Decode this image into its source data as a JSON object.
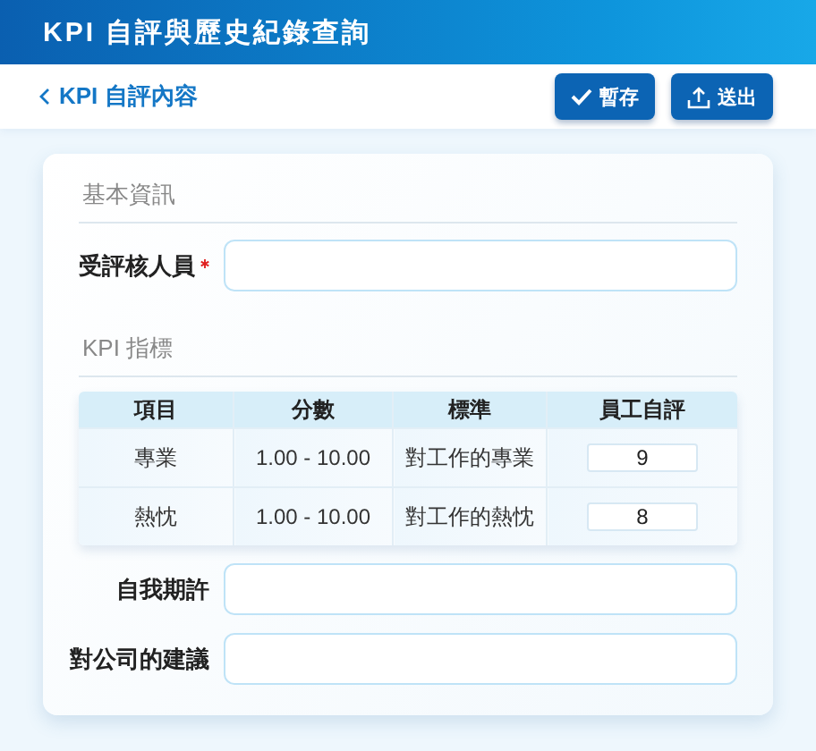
{
  "window": {
    "title": "KPI 自評與歷史紀錄查詢"
  },
  "nav": {
    "back_label": "KPI 自評內容"
  },
  "buttons": [
    {
      "label": "暫存",
      "kind": "save"
    },
    {
      "label": "送出",
      "kind": "submit"
    }
  ],
  "basic_info": {
    "title": "基本資訊",
    "fields": [
      {
        "label": "受評核人員",
        "required": true
      }
    ]
  },
  "kpi": {
    "title": "KPI 指標",
    "columns": [
      "項目",
      "分數",
      "標準",
      "員工自評"
    ],
    "rows": [
      {
        "cells": [
          "專業",
          "1.00 - 10.00",
          "對工作的專業"
        ],
        "self_score": "9"
      },
      {
        "cells": [
          "熱忱",
          "1.00 - 10.00",
          "對工作的熱忱"
        ],
        "self_score": "8"
      }
    ]
  },
  "extra_fields": [
    {
      "label": "自我期許",
      "required": false
    },
    {
      "label": "對公司的建議",
      "required": false
    }
  ]
}
